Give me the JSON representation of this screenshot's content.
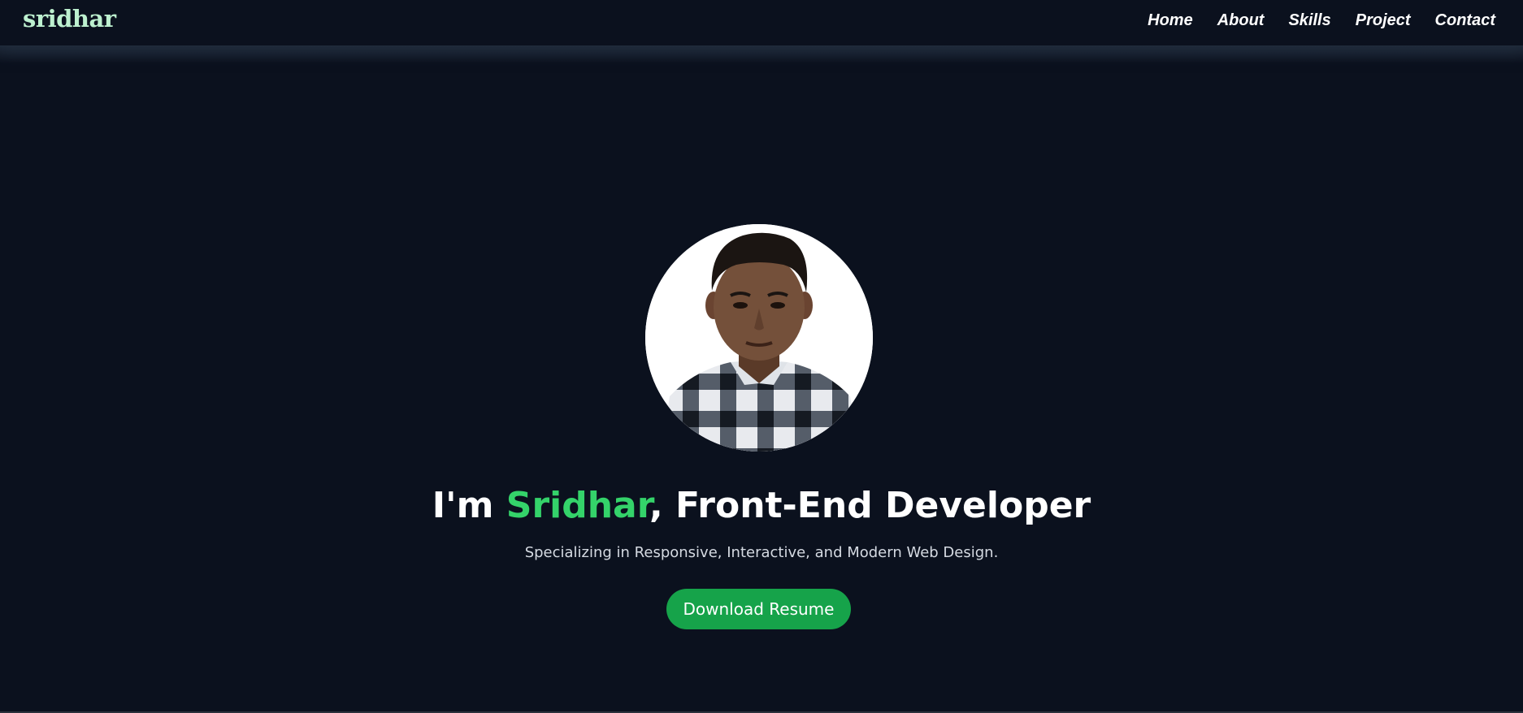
{
  "header": {
    "logo": "sridhar",
    "nav": [
      "Home",
      "About",
      "Skills",
      "Project",
      "Contact"
    ]
  },
  "hero": {
    "avatar": "profile-photo",
    "title_prefix": "I'm ",
    "title_name": "Sridhar",
    "title_suffix": ", Front-End Developer",
    "subtitle": "Specializing in Responsive, Interactive, and Modern Web Design.",
    "button_label": "Download Resume"
  },
  "colors": {
    "background": "#0b111e",
    "accent": "#34d36a",
    "button": "#16a34a",
    "logo": "#bdf0cf"
  }
}
